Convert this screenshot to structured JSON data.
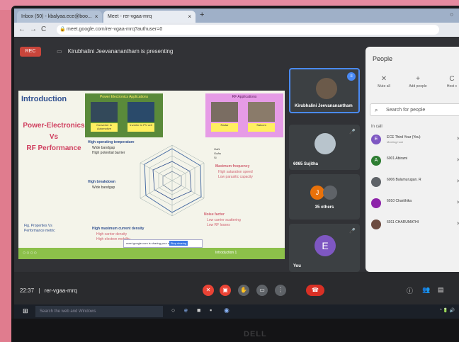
{
  "browser": {
    "tabs": [
      {
        "label": "Inbox (50) - kbalyaa.ece@boo..."
      },
      {
        "label": "Meet - rer-vgaa-mrq"
      }
    ],
    "tab_close": "×",
    "new_tab": "+",
    "url": "meet.google.com/rer-vgaa-mrq?authuser=0"
  },
  "meet": {
    "rec_label": "REC",
    "presenting_text": "Kirubhalini Jeevananantham is presenting",
    "slide": {
      "title": "Introduction",
      "main_title_line1": "Power-Electronics",
      "main_title_line2": "Vs",
      "main_title_line3": "RF Performance",
      "pe_apps_title": "Power Electronics Applications",
      "pe_cap1": "Converter in Automotive",
      "pe_cap2": "Inverter in PV cell",
      "rf_apps_title": "RF Applications",
      "rf_cap1": "Radar",
      "rf_cap2": "Satcom",
      "high_temp": "High operating temperature",
      "wide_bandgap": "Wide bandgap",
      "high_barrier": "High potential barrier",
      "high_breakdown": "High breakdown",
      "wide_bandgap2": "Wide bandgap",
      "max_freq": "Maximum frequency",
      "high_sat": "High saturation speed",
      "low_cap": "Low parasitic capacity",
      "noise": "Noise factor",
      "low_scatter": "Low carrier scattering",
      "low_rf": "Low RF losses",
      "high_current": "High maximum current density",
      "high_carrier": "High carrier density",
      "high_electron": "High electron mobility",
      "fig_caption_1": "Fig. Properties Vs",
      "fig_caption_2": "Performance metric",
      "popup_text": "meet.google.com is sharing your screen",
      "popup_btn": "Stop sharing",
      "slide_number": "Introduction 1",
      "legend": [
        "GaN",
        "GaAs",
        "Si"
      ]
    },
    "tiles": [
      {
        "name": "Kirubhalini Jeevananantham"
      },
      {
        "name": "6065 Sujitha"
      },
      {
        "name": "35 others",
        "initial1": "J"
      },
      {
        "name": "You",
        "initial": "E"
      }
    ],
    "people_panel": {
      "title": "People",
      "actions": [
        "Mute all",
        "Add people",
        "Host c"
      ],
      "search_placeholder": "Search for people",
      "in_call": "In call",
      "participants": [
        {
          "name": "ECE Third Year (You)",
          "sub": "Meeting host",
          "initial": "E",
          "color": "#7e57c2"
        },
        {
          "name": "6001 Abirami",
          "sub": "",
          "initial": "A",
          "color": "#2e7d32"
        },
        {
          "name": "6006 Balamurugan. R",
          "sub": "",
          "initial": "",
          "color": "#5f6368"
        },
        {
          "name": "6010 Charithika",
          "sub": "",
          "initial": "",
          "color": "#8e24aa"
        },
        {
          "name": "6011 CHARUMATHI",
          "sub": "",
          "initial": "",
          "color": "#6d4c41"
        }
      ]
    },
    "bottom": {
      "time": "22:37",
      "separator": "|",
      "meeting_code": "rer-vgaa-mrq"
    }
  },
  "taskbar": {
    "search_text": "Search the web and Windows"
  },
  "brand": "DELL",
  "colors": {
    "accent_blue": "#4a8af4",
    "end_call_red": "#d93025",
    "mic_off_red": "#ea4335"
  }
}
